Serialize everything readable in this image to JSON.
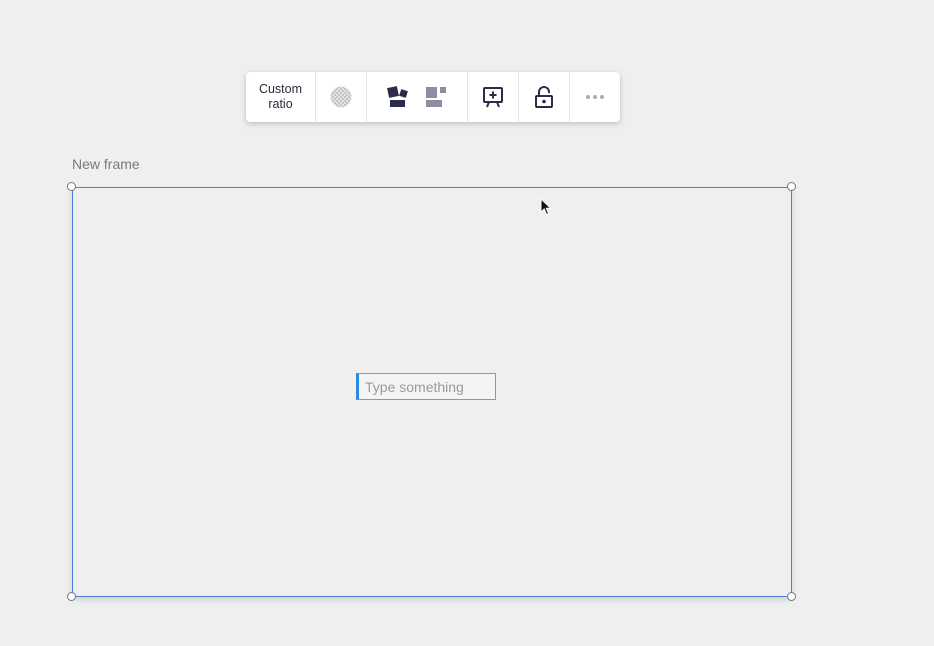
{
  "toolbar": {
    "ratio_label": "Custom\nratio",
    "icons": {
      "fill": "transparent-fill-icon",
      "layout_scatter": "scatter-layout-icon",
      "layout_grid": "grid-layout-icon",
      "present": "presentation-add-icon",
      "lock": "lock-icon",
      "more": "more-options-icon"
    }
  },
  "frame": {
    "title": "New frame",
    "border_color": "#4a7fd6"
  },
  "text_input": {
    "placeholder": "Type something",
    "value": ""
  },
  "colors": {
    "background": "#efefef",
    "icon_dark": "#2b2b4a",
    "icon_muted": "#8f8da6",
    "input_accent": "#2a8be0"
  }
}
